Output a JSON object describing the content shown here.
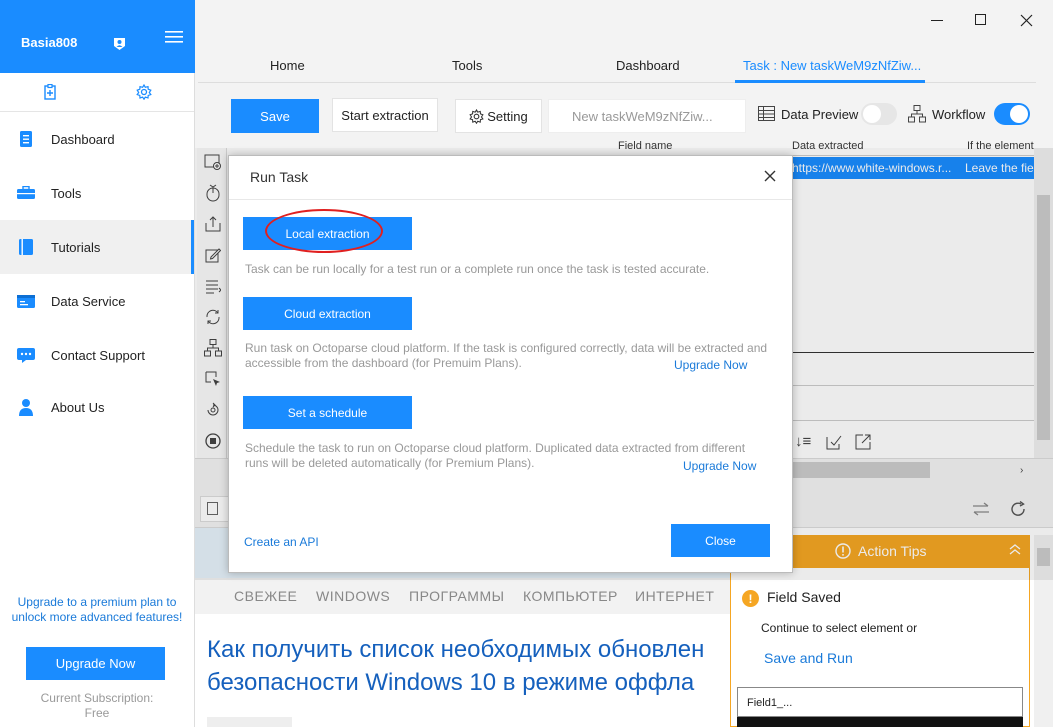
{
  "sidebar": {
    "username": "Basia808",
    "items": [
      {
        "label": "Dashboard",
        "icon": "dashboard-icon"
      },
      {
        "label": "Tools",
        "icon": "tools-icon"
      },
      {
        "label": "Tutorials",
        "icon": "tutorials-icon"
      },
      {
        "label": "Data Service",
        "icon": "data-service-icon"
      },
      {
        "label": "Contact Support",
        "icon": "chat-icon"
      },
      {
        "label": "About Us",
        "icon": "user-icon"
      }
    ],
    "upgrade_text_1": "Upgrade to a premium plan to",
    "upgrade_text_2": "unlock more advanced features!",
    "upgrade_button": "Upgrade Now",
    "subscription_label": "Current Subscription:",
    "subscription_value": "Free"
  },
  "tabs": [
    "Home",
    "Tools",
    "Dashboard",
    "Task : New taskWeM9zNfZiw..."
  ],
  "toolbar": {
    "save": "Save",
    "start_extraction": "Start extraction",
    "setting": "Setting",
    "task_name": "New taskWeM9zNfZiw...",
    "data_preview": "Data Preview",
    "workflow": "Workflow"
  },
  "table": {
    "headers": [
      "Field name",
      "Data extracted",
      "If the element"
    ],
    "row": [
      "",
      "https://www.white-windows.r...",
      "Leave the fie"
    ]
  },
  "browser": {
    "nav": [
      "СВЕЖЕЕ",
      "WINDOWS",
      "ПРОГРАММЫ",
      "КОМПЬЮТЕР",
      "ИНТЕРНЕТ"
    ],
    "headline_1": "Как получить список необходимых обновлен",
    "headline_2": "безопасности Windows 10 в режиме оффла"
  },
  "action_tips": {
    "title": "Action Tips",
    "field_saved": "Field Saved",
    "continue": "Continue to select element or",
    "save_run": "Save and Run",
    "field": "Field1_..."
  },
  "modal": {
    "title": "Run Task",
    "local_button": "Local extraction",
    "local_desc": "Task can be run locally for a test run or a complete run once the task is tested accurate.",
    "cloud_button": "Cloud extraction",
    "cloud_desc_1": "Run task on Octoparse cloud platform. If the task is configured correctly, data will be extracted and",
    "cloud_desc_2": "accessible from the dashboard (for Premuim Plans).",
    "upgrade_1": "Upgrade Now",
    "schedule_button": "Set a schedule",
    "schedule_desc_1": "Schedule the task to run on Octoparse cloud platform. Duplicated data extracted from different",
    "schedule_desc_2": "runs will be deleted automatically (for Premium Plans).",
    "upgrade_2": "Upgrade Now",
    "api_link": "Create an API",
    "close_button": "Close"
  },
  "colors": {
    "accent": "#1a8cff",
    "annotation": "#e02020",
    "tips": "#f5a623"
  }
}
